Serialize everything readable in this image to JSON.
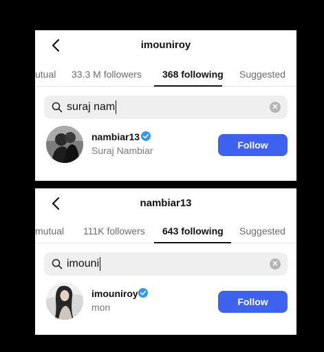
{
  "panels": [
    {
      "title": "imouniroy",
      "tabs": [
        "utual",
        "33.3 M followers",
        "368 following",
        "Suggested"
      ],
      "active_tab_index": 2,
      "search_value": "suraj nam",
      "result": {
        "username": "nambiar13",
        "full_name": "Suraj Nambiar",
        "verified": true,
        "follow_label": "Follow"
      }
    },
    {
      "title": "nambiar13",
      "tabs": [
        "mutual",
        "111K followers",
        "643 following",
        "Suggested"
      ],
      "active_tab_index": 2,
      "search_value": "imouni",
      "result": {
        "username": "imouniroy",
        "full_name": "mon",
        "verified": true,
        "follow_label": "Follow"
      }
    }
  ],
  "colors": {
    "follow_button": "#3e62f0",
    "verified_badge": "#3797f0",
    "background": "#000000"
  },
  "icons": [
    "back-arrow-icon",
    "search-icon",
    "clear-icon",
    "verified-badge-icon"
  ]
}
